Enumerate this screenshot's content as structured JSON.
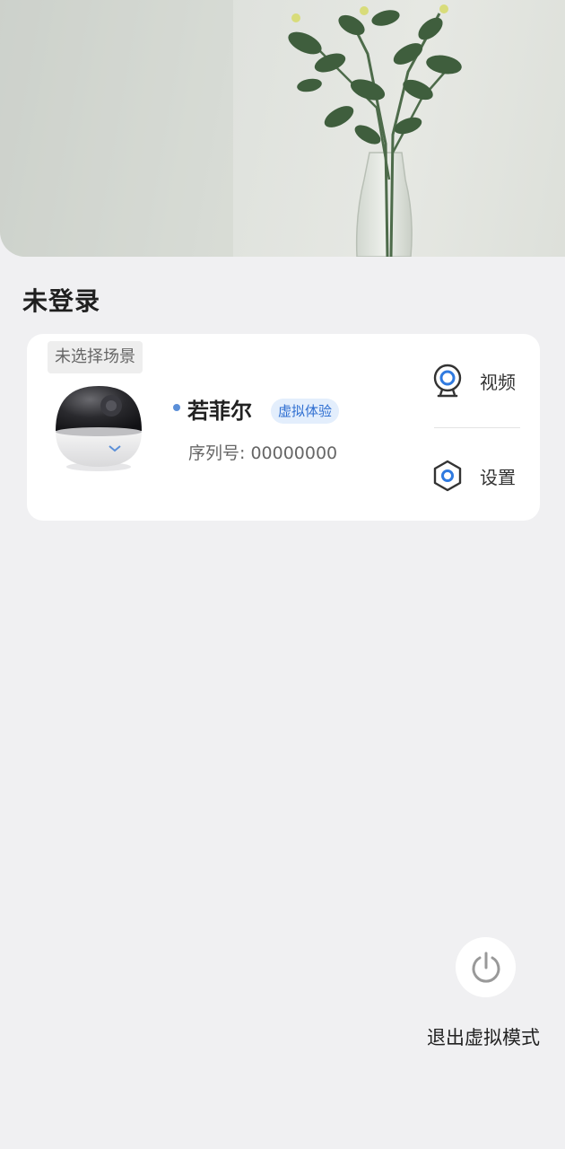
{
  "header": {
    "title": "未登录"
  },
  "device_card": {
    "scene_tag": "未选择场景",
    "device_name": "若菲尔",
    "badge": "虚拟体验",
    "serial": "序列号: 00000000",
    "actions": [
      {
        "label": "视频",
        "icon": "webcam-icon"
      },
      {
        "label": "设置",
        "icon": "settings-hexagon-icon"
      }
    ]
  },
  "exit": {
    "label": "退出虚拟模式",
    "icon": "power-icon"
  },
  "colors": {
    "accent": "#2f6fd1",
    "background": "#f0f0f2",
    "card": "#ffffff"
  }
}
